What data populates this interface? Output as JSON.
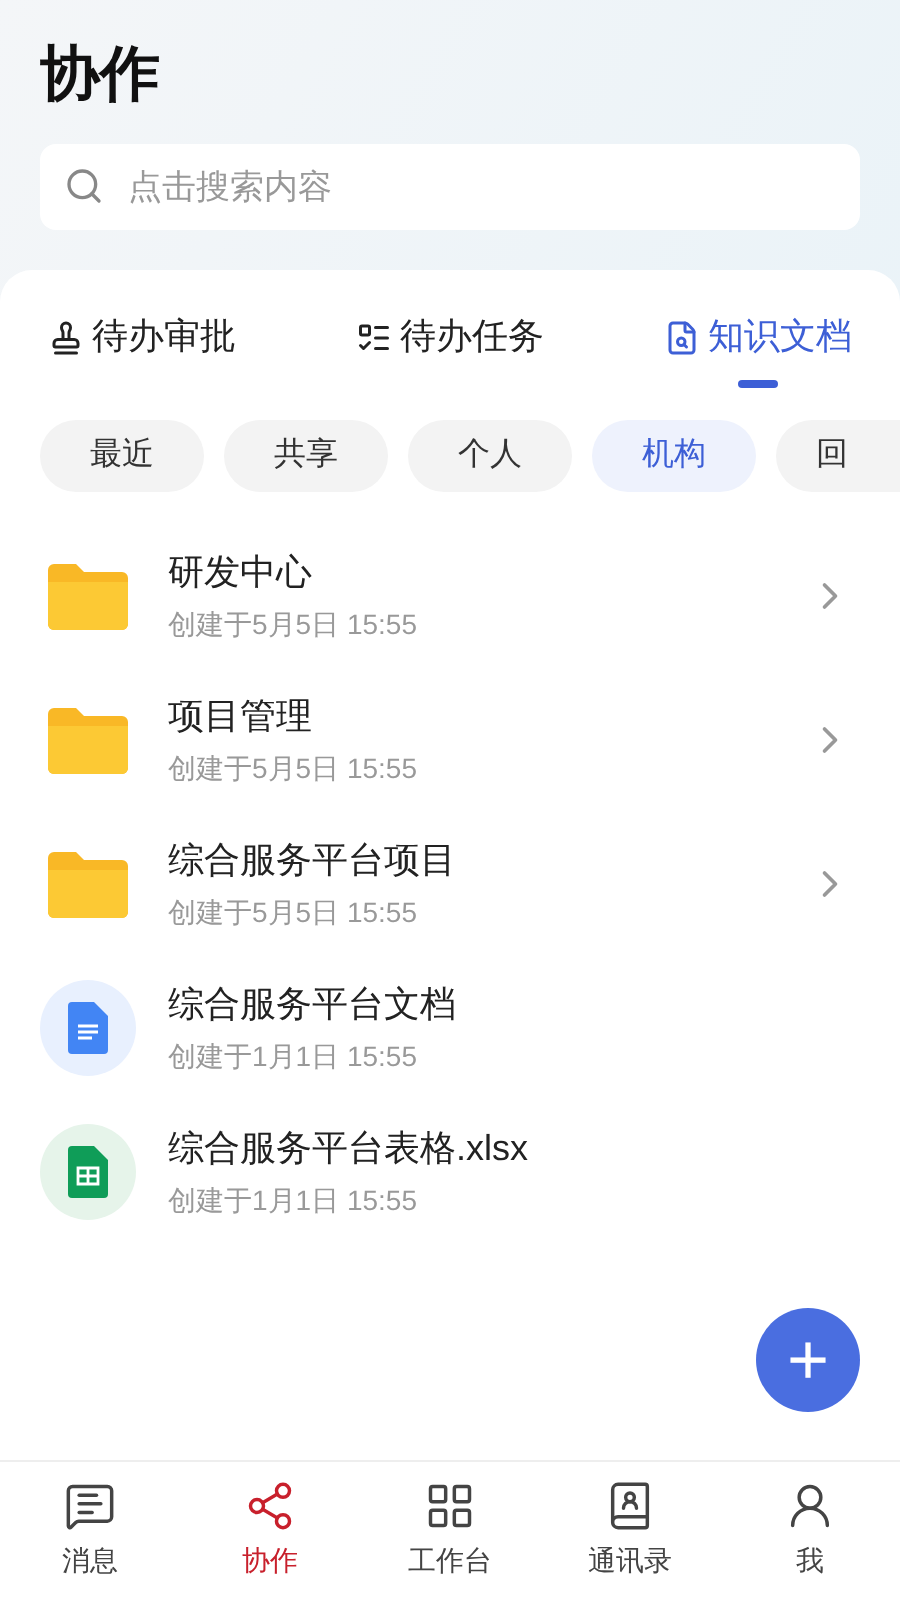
{
  "title": "协作",
  "search": {
    "placeholder": "点击搜索内容"
  },
  "tabs": [
    {
      "label": "待办审批",
      "kind": "stamp",
      "selected": false
    },
    {
      "label": "待办任务",
      "kind": "list",
      "selected": false
    },
    {
      "label": "知识文档",
      "kind": "doc",
      "selected": true
    }
  ],
  "filters": [
    {
      "label": "最近",
      "selected": false
    },
    {
      "label": "共享",
      "selected": false
    },
    {
      "label": "个人",
      "selected": false
    },
    {
      "label": "机构",
      "selected": true
    },
    {
      "label": "回",
      "selected": false
    }
  ],
  "files": [
    {
      "kind": "folder",
      "name": "研发中心",
      "meta": "创建于5月5日 15:55"
    },
    {
      "kind": "folder",
      "name": "项目管理",
      "meta": "创建于5月5日 15:55"
    },
    {
      "kind": "folder",
      "name": "综合服务平台项目",
      "meta": "创建于5月5日 15:55"
    },
    {
      "kind": "doc",
      "name": "综合服务平台文档",
      "meta": "创建于1月1日 15:55"
    },
    {
      "kind": "sheet",
      "name": "综合服务平台表格.xlsx",
      "meta": "创建于1月1日 15:55"
    }
  ],
  "fab": "+",
  "nav": [
    {
      "label": "消息",
      "kind": "message",
      "selected": false
    },
    {
      "label": "协作",
      "kind": "share",
      "selected": true
    },
    {
      "label": "工作台",
      "kind": "grid",
      "selected": false
    },
    {
      "label": "通讯录",
      "kind": "contacts",
      "selected": false
    },
    {
      "label": "我",
      "kind": "user",
      "selected": false
    }
  ]
}
